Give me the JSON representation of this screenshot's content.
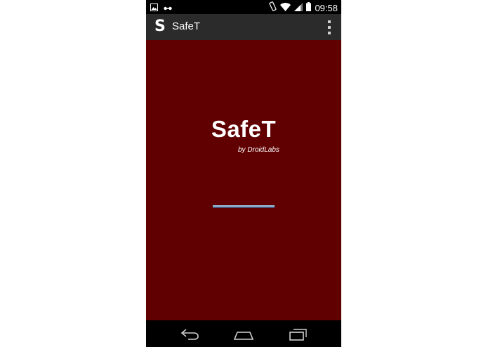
{
  "status_bar": {
    "time": "09:58",
    "icons": [
      "image-icon",
      "link-icon",
      "vibrate-icon",
      "wifi-icon",
      "signal-icon",
      "battery-icon"
    ]
  },
  "action_bar": {
    "app_icon_letter": "S",
    "title": "SafeT",
    "overflow_icon": "overflow-menu-icon"
  },
  "splash": {
    "title": "SafeT",
    "subtitle": "by DroidLabs",
    "background_color": "#600000",
    "progress": 1.0
  },
  "nav_bar": {
    "buttons": [
      "back-icon",
      "home-icon",
      "recents-icon"
    ]
  }
}
